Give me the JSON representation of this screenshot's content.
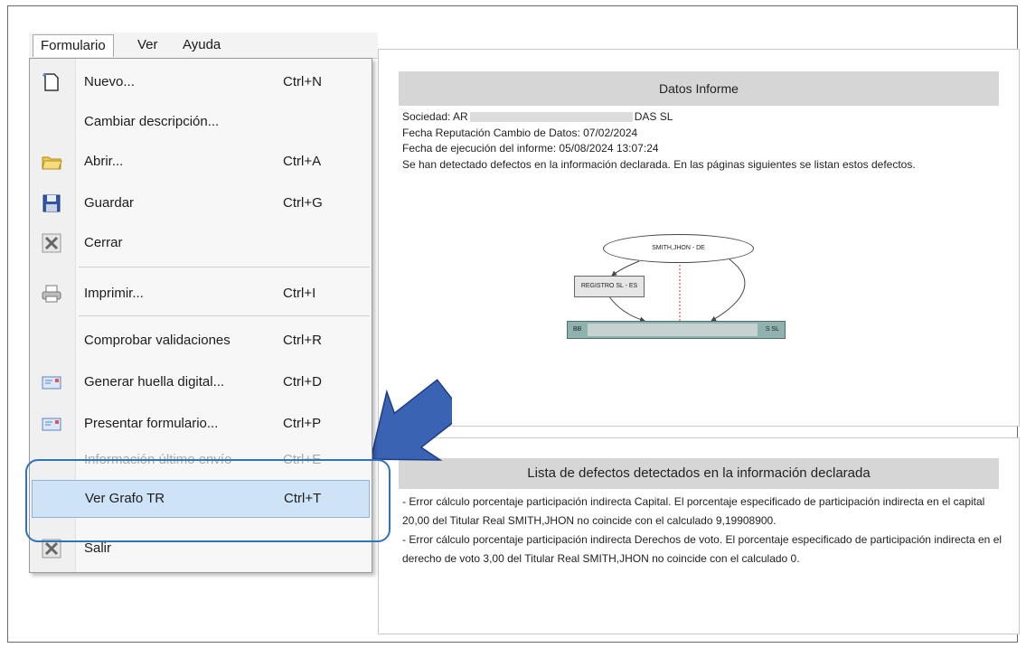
{
  "menubar": {
    "formulario": "Formulario",
    "ver": "Ver",
    "ayuda": "Ayuda"
  },
  "menu": {
    "items": [
      {
        "label": "Nuevo...",
        "shortcut": "Ctrl+N",
        "icon": "new-document-icon"
      },
      {
        "label": "Cambiar descripción...",
        "shortcut": "",
        "icon": ""
      },
      {
        "label": "Abrir...",
        "shortcut": "Ctrl+A",
        "icon": "folder-open-icon"
      },
      {
        "label": "Guardar",
        "shortcut": "Ctrl+G",
        "icon": "save-icon"
      },
      {
        "label": "Cerrar",
        "shortcut": "",
        "icon": "close-icon"
      },
      {
        "label": "Imprimir...",
        "shortcut": "Ctrl+I",
        "icon": "printer-icon"
      },
      {
        "label": "Comprobar validaciones",
        "shortcut": "Ctrl+R",
        "icon": ""
      },
      {
        "label": "Generar huella digital...",
        "shortcut": "Ctrl+D",
        "icon": "envelope-icon"
      },
      {
        "label": "Presentar formulario...",
        "shortcut": "Ctrl+P",
        "icon": "envelope-icon"
      },
      {
        "label": "Información último envío",
        "shortcut": "Ctrl+E",
        "icon": ""
      },
      {
        "label": "Ver Grafo TR",
        "shortcut": "Ctrl+T",
        "icon": ""
      },
      {
        "label": "Salir",
        "shortcut": "",
        "icon": "exit-icon"
      }
    ]
  },
  "report": {
    "header": "Datos Informe",
    "sociedad_prefix": "Sociedad: AR",
    "sociedad_suffix": "DAS SL",
    "fecha_reputacion": "Fecha Reputación Cambio de Datos: 07/02/2024",
    "fecha_ejecucion": "Fecha de ejecución del informe: 05/08/2024 13:07:24",
    "aviso": "Se han detectado defectos en la información declarada. En las páginas siguientes se listan estos defectos."
  },
  "graph": {
    "top_node": "SMITH,JHON - DE",
    "mid_node": "REGISTRO SL - ES",
    "bottom_left": "BB",
    "bottom_right": "S SL"
  },
  "defects": {
    "header": "Lista de defectos detectados en la información declarada",
    "d1": "- Error cálculo porcentaje participación indirecta Capital. El porcentaje especificado de participación indirecta en el capital 20,00 del Titular Real SMITH,JHON no coincide con el calculado 9,19908900.",
    "d2": "- Error cálculo porcentaje participación indirecta Derechos de voto. El porcentaje especificado de participación indirecta en el derecho de voto 3,00 del Titular Real SMITH,JHON no coincide con el calculado 0."
  },
  "colors": {
    "highlight_border": "#2f73b8",
    "arrow": "#3a63b4",
    "graph_bar": "#8fb2ae"
  }
}
